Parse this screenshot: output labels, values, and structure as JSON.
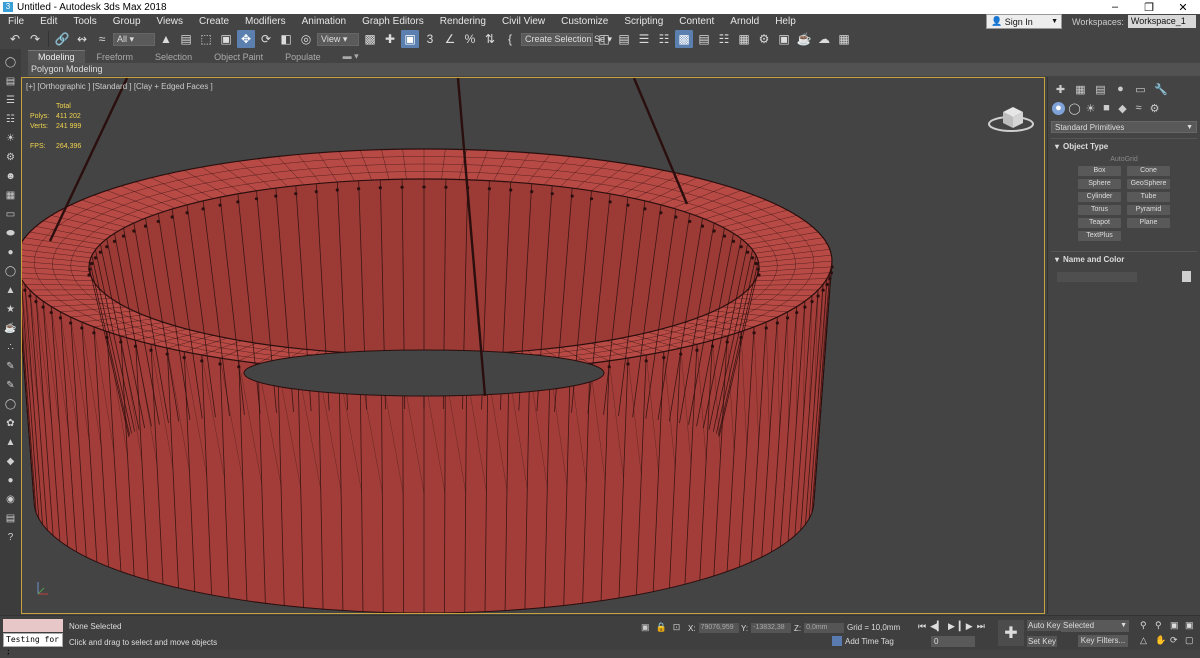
{
  "window": {
    "title": "Untitled - Autodesk 3ds Max 2018",
    "app_icon": "3ds-max-icon"
  },
  "menu": [
    "File",
    "Edit",
    "Tools",
    "Group",
    "Views",
    "Create",
    "Modifiers",
    "Animation",
    "Graph Editors",
    "Rendering",
    "Civil View",
    "Customize",
    "Scripting",
    "Content",
    "Arnold",
    "Help"
  ],
  "account": {
    "sign_in": "Sign In",
    "workspaces_label": "Workspaces:",
    "workspace_value": "Workspace_1"
  },
  "toolbar": {
    "filter_value": "All",
    "ref_coord_value": "View",
    "selection_set_value": "Create Selection Se"
  },
  "ribbon": {
    "tabs": [
      "Modeling",
      "Freeform",
      "Selection",
      "Object Paint",
      "Populate"
    ],
    "active_tab": "Modeling",
    "sub_label": "Polygon Modeling"
  },
  "viewport": {
    "label": "[+] [Orthographic ] [Standard ] [Clay + Edged Faces ]",
    "stats": {
      "total_label": "Total",
      "polys_label": "Polys:",
      "polys_value": "411 202",
      "verts_label": "Verts:",
      "verts_value": "241 999",
      "fps_label": "FPS:",
      "fps_value": "264,396"
    },
    "colors": {
      "object": "#b84a45",
      "wire": "#2a0f0e",
      "frame": "#c7a23c"
    }
  },
  "command_panel": {
    "primitive_type": "Standard Primitives",
    "object_type_title": "Object Type",
    "autogrid_label": "AutoGrid",
    "buttons": [
      "Box",
      "Cone",
      "Sphere",
      "GeoSphere",
      "Cylinder",
      "Tube",
      "Torus",
      "Pyramid",
      "Teapot",
      "Plane",
      "TextPlus"
    ],
    "name_color_title": "Name and Color"
  },
  "status": {
    "listener_text": "Testing for ;",
    "selection": "None Selected",
    "prompt": "Click and drag to select and move objects",
    "x_label": "X:",
    "x_value": "79076,959",
    "y_label": "Y:",
    "y_value": "-13832,38",
    "z_label": "Z:",
    "z_value": "0,0mm",
    "grid": "Grid = 10,0mm",
    "add_time_tag": "Add Time Tag",
    "frame_value": "0",
    "auto_key": "Auto Key",
    "set_key": "Set Key",
    "selected_value": "Selected",
    "key_filters": "Key Filters..."
  }
}
